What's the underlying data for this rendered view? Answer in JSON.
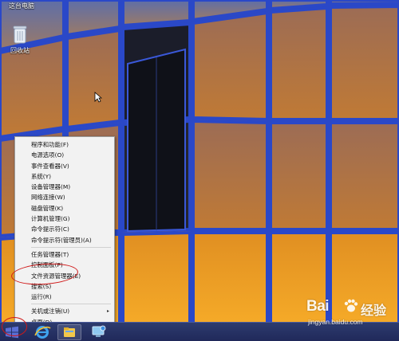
{
  "desktop": {
    "icons": [
      {
        "label": "这台电脑",
        "icon": "computer-icon"
      },
      {
        "label": "回收站",
        "icon": "recycle-bin-icon"
      }
    ]
  },
  "context_menu": {
    "items": [
      {
        "label": "程序和功能(F)"
      },
      {
        "label": "电源选项(O)"
      },
      {
        "label": "事件查看器(V)"
      },
      {
        "label": "系统(Y)"
      },
      {
        "label": "设备管理器(M)"
      },
      {
        "label": "网络连接(W)"
      },
      {
        "label": "磁盘管理(K)"
      },
      {
        "label": "计算机管理(G)"
      },
      {
        "label": "命令提示符(C)"
      },
      {
        "label": "命令提示符(管理员)(A)"
      },
      {
        "label": "任务管理器(T)"
      },
      {
        "label": "控制面板(P)"
      },
      {
        "label": "文件资源管理器(E)",
        "highlighted": true
      },
      {
        "label": "搜索(S)"
      },
      {
        "label": "运行(R)"
      },
      {
        "label": "关机或注销(U)",
        "submenu": true
      },
      {
        "label": "桌面(D)"
      }
    ],
    "submenu_arrow": "▸",
    "highlight_color": "#d01818"
  },
  "taskbar": {
    "items": [
      "start-icon",
      "internet-explorer-icon",
      "file-explorer-icon",
      "network-icon"
    ]
  },
  "watermark": {
    "brand": "Bai",
    "brand_suffix": "经验",
    "url": "jingyan.baidu.com"
  }
}
